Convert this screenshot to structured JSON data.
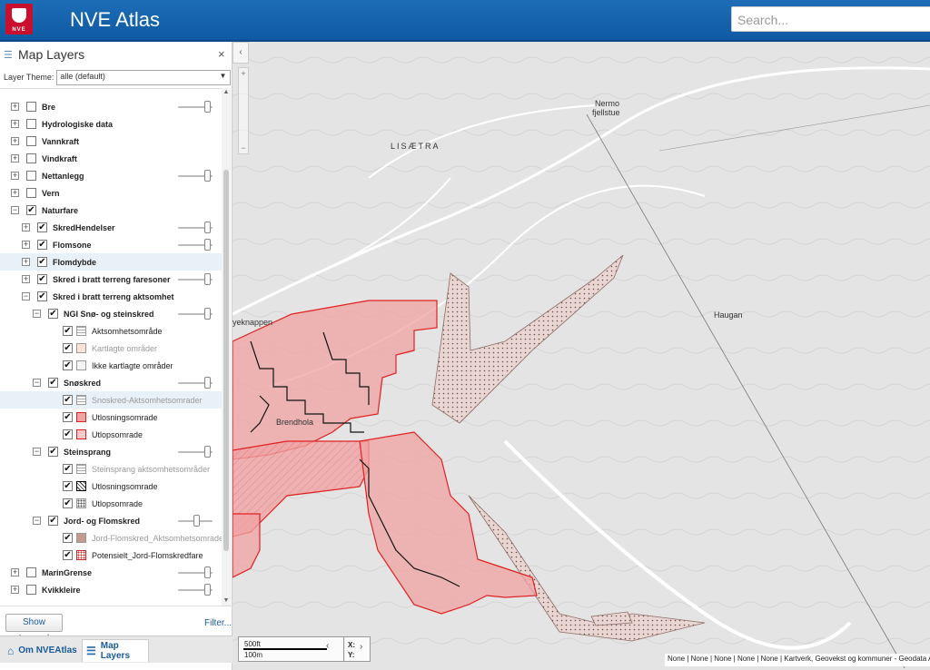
{
  "header": {
    "title": "NVE Atlas",
    "logo_text": "NVE",
    "search_placeholder": "Search..."
  },
  "panel": {
    "title": "Map Layers",
    "theme_label": "Layer Theme:",
    "theme_value": "alle (default)",
    "close": "×"
  },
  "layers": [
    {
      "label": "Bre",
      "checked": false,
      "bold": true,
      "level": 0,
      "expander": "+",
      "slider": 0.95
    },
    {
      "label": "Hydrologiske data",
      "checked": false,
      "bold": true,
      "level": 0,
      "expander": "+"
    },
    {
      "label": "Vannkraft",
      "checked": false,
      "bold": true,
      "level": 0,
      "expander": "+"
    },
    {
      "label": "Vindkraft",
      "checked": false,
      "bold": true,
      "level": 0,
      "expander": "+"
    },
    {
      "label": "Nettanlegg",
      "checked": false,
      "bold": true,
      "level": 0,
      "expander": "+",
      "slider": 0.95
    },
    {
      "label": "Vern",
      "checked": false,
      "bold": true,
      "level": 0,
      "expander": "+"
    },
    {
      "label": "Naturfare",
      "checked": true,
      "bold": true,
      "level": 0,
      "expander": "−"
    },
    {
      "label": "SkredHendelser",
      "checked": true,
      "bold": true,
      "level": 1,
      "expander": "+",
      "slider": 0.95
    },
    {
      "label": "Flomsone",
      "checked": true,
      "bold": true,
      "level": 1,
      "expander": "+",
      "slider": 0.95
    },
    {
      "label": "Flomdybde",
      "checked": true,
      "bold": true,
      "level": 1,
      "expander": "+",
      "highlight": true
    },
    {
      "label": "Skred i bratt terreng faresoner",
      "checked": true,
      "bold": true,
      "level": 1,
      "expander": "+",
      "slider": 0.95
    },
    {
      "label": "Skred i bratt terreng aktsomhet",
      "checked": true,
      "bold": true,
      "level": 1,
      "expander": "−"
    },
    {
      "label": "NGI Snø- og steinskred",
      "checked": true,
      "bold": true,
      "level": 2,
      "expander": "−",
      "slider": 0.95
    },
    {
      "label": "Aktsomhetsområde",
      "checked": true,
      "level": 3,
      "swatch": "lines"
    },
    {
      "label": "Kartlagte områder",
      "checked": true,
      "level": 3,
      "swatch": "peach",
      "grey": true
    },
    {
      "label": "Ikke kartlagte områder",
      "checked": true,
      "level": 3,
      "swatch": "lightgrey"
    },
    {
      "label": "Snøskred",
      "checked": true,
      "bold": true,
      "level": 2,
      "expander": "−",
      "slider": 0.95
    },
    {
      "label": "Snoskred-Aktsomhetsomrader",
      "checked": true,
      "level": 3,
      "swatch": "lines",
      "grey": true,
      "highlight": true
    },
    {
      "label": "Utlosningsomrade",
      "checked": true,
      "level": 3,
      "swatch": "redhatch"
    },
    {
      "label": "Utlopsomrade",
      "checked": true,
      "level": 3,
      "swatch": "redlight"
    },
    {
      "label": "Steinsprang",
      "checked": true,
      "bold": true,
      "level": 2,
      "expander": "−",
      "slider": 0.95
    },
    {
      "label": "Steinsprang aktsomhetsområder",
      "checked": true,
      "level": 3,
      "swatch": "lines",
      "grey": true
    },
    {
      "label": "Utlosningsomrade",
      "checked": true,
      "level": 3,
      "swatch": "blackhatch"
    },
    {
      "label": "Utlopsomrade",
      "checked": true,
      "level": 3,
      "swatch": "dots"
    },
    {
      "label": "Jord- og Flomskred",
      "checked": true,
      "bold": true,
      "level": 2,
      "expander": "−",
      "slider": 0.55
    },
    {
      "label": "Jord-Flomskred_Aktsomhetsomrader",
      "checked": true,
      "level": 3,
      "swatch": "brown",
      "grey": true
    },
    {
      "label": "Potensielt_Jord-Flomskredfare",
      "checked": true,
      "level": 3,
      "swatch": "reddots"
    },
    {
      "label": "MarinGrense",
      "checked": false,
      "bold": true,
      "level": 0,
      "expander": "+",
      "slider": 0.95
    },
    {
      "label": "Kvikkleire",
      "checked": false,
      "bold": true,
      "level": 0,
      "expander": "+",
      "slider": 0.95
    }
  ],
  "footer": {
    "legend_button": "Show Legend",
    "filter_link": "Filter..."
  },
  "tabs": [
    {
      "label": "Om NVEAtlas",
      "icon": "home-icon"
    },
    {
      "label": "Map Layers",
      "icon": "layers-icon",
      "active": true
    }
  ],
  "map": {
    "places": [
      {
        "name": "LISÆTRA"
      },
      {
        "name": "Nermo"
      },
      {
        "name": "fjellstue"
      },
      {
        "name": "Haugan"
      },
      {
        "name": "yeknappen"
      },
      {
        "name": "Brendhola"
      }
    ],
    "scale": {
      "ft": "500ft",
      "m": "100m"
    },
    "coords": {
      "x": "X:",
      "y": "Y:"
    },
    "attribution": "None | None | None | None | None | Kartverk, Geovekst og kommuner - Geodata AS"
  }
}
